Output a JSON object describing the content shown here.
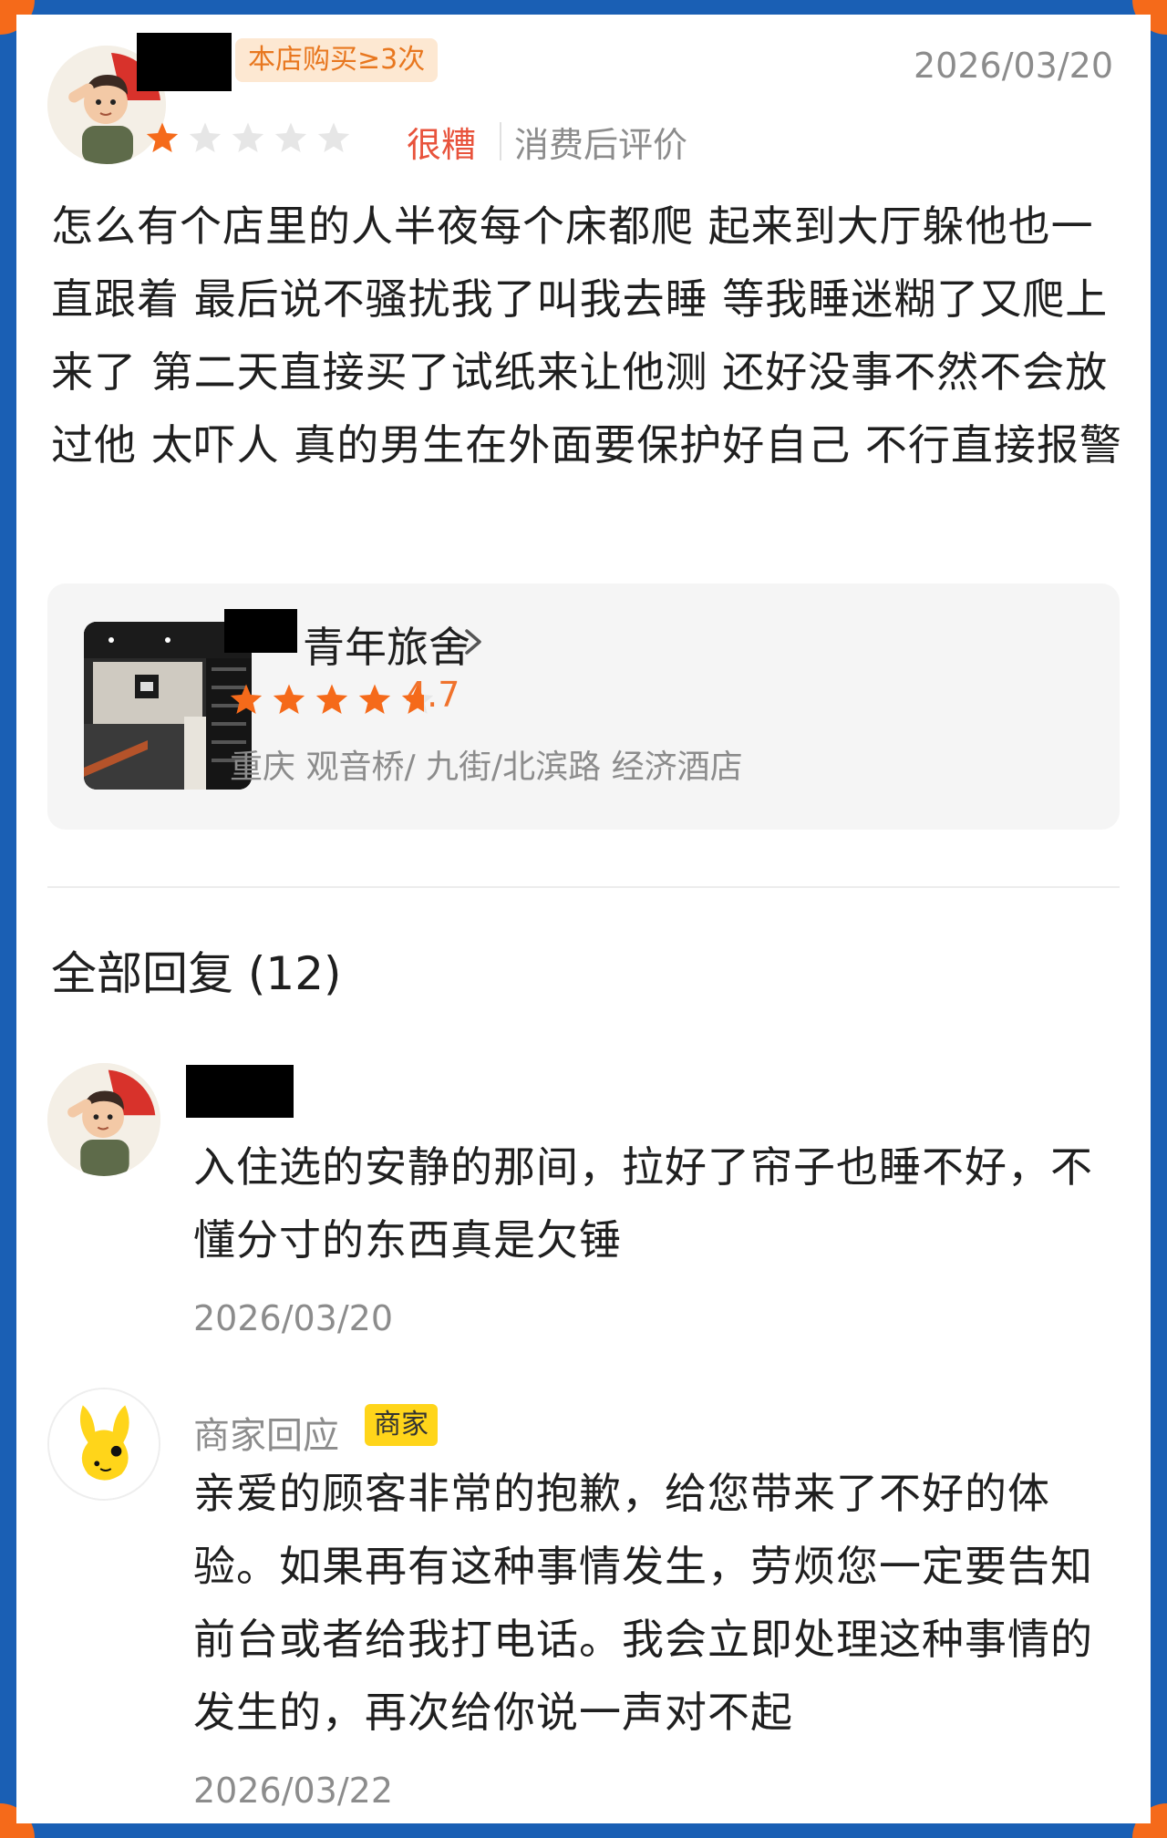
{
  "review": {
    "badge": "本店购买≥3次",
    "date": "2026/03/20",
    "rating_stars": 1,
    "rating_max": 5,
    "rating_label": "很糟",
    "post_tag": "消费后评价",
    "text": "怎么有个店里的人半夜每个床都爬 起来到大厅躲他也一直跟着 最后说不骚扰我了叫我去睡 等我睡迷糊了又爬上来了 第二天直接买了试纸来让他测 还好没事不然不会放过他 太吓人 真的男生在外面要保护好自己 不行直接报警"
  },
  "shop": {
    "name_suffix": "青年旅舍",
    "rating": 4.7,
    "rating_display": "4.7",
    "address": "重庆 观音桥/ 九街/北滨路 经济酒店"
  },
  "replies": {
    "title": "全部回复 (12)",
    "items": [
      {
        "text": "入住选的安静的那间，拉好了帘子也睡不好，不懂分寸的东西真是欠锤",
        "date": "2026/03/20"
      },
      {
        "author": "商家回应",
        "badge": "商家",
        "text": "亲爱的顾客非常的抱歉，给您带来了不好的体验。如果再有这种事情发生，劳烦您一定要告知前台或者给我打电话。我会立即处理这种事情的发生的，再次给你说一声对不起",
        "date": "2026/03/22"
      }
    ]
  },
  "colors": {
    "frame": "#1a5fb4",
    "corner": "#f56a1a",
    "star_active": "#f56a1a",
    "star_inactive": "#e6e6e6",
    "rating_label": "#e8533c",
    "merchant_badge": "#ffd51a"
  },
  "icons": {
    "chevron": "chevron-right-icon",
    "star": "star-icon"
  }
}
